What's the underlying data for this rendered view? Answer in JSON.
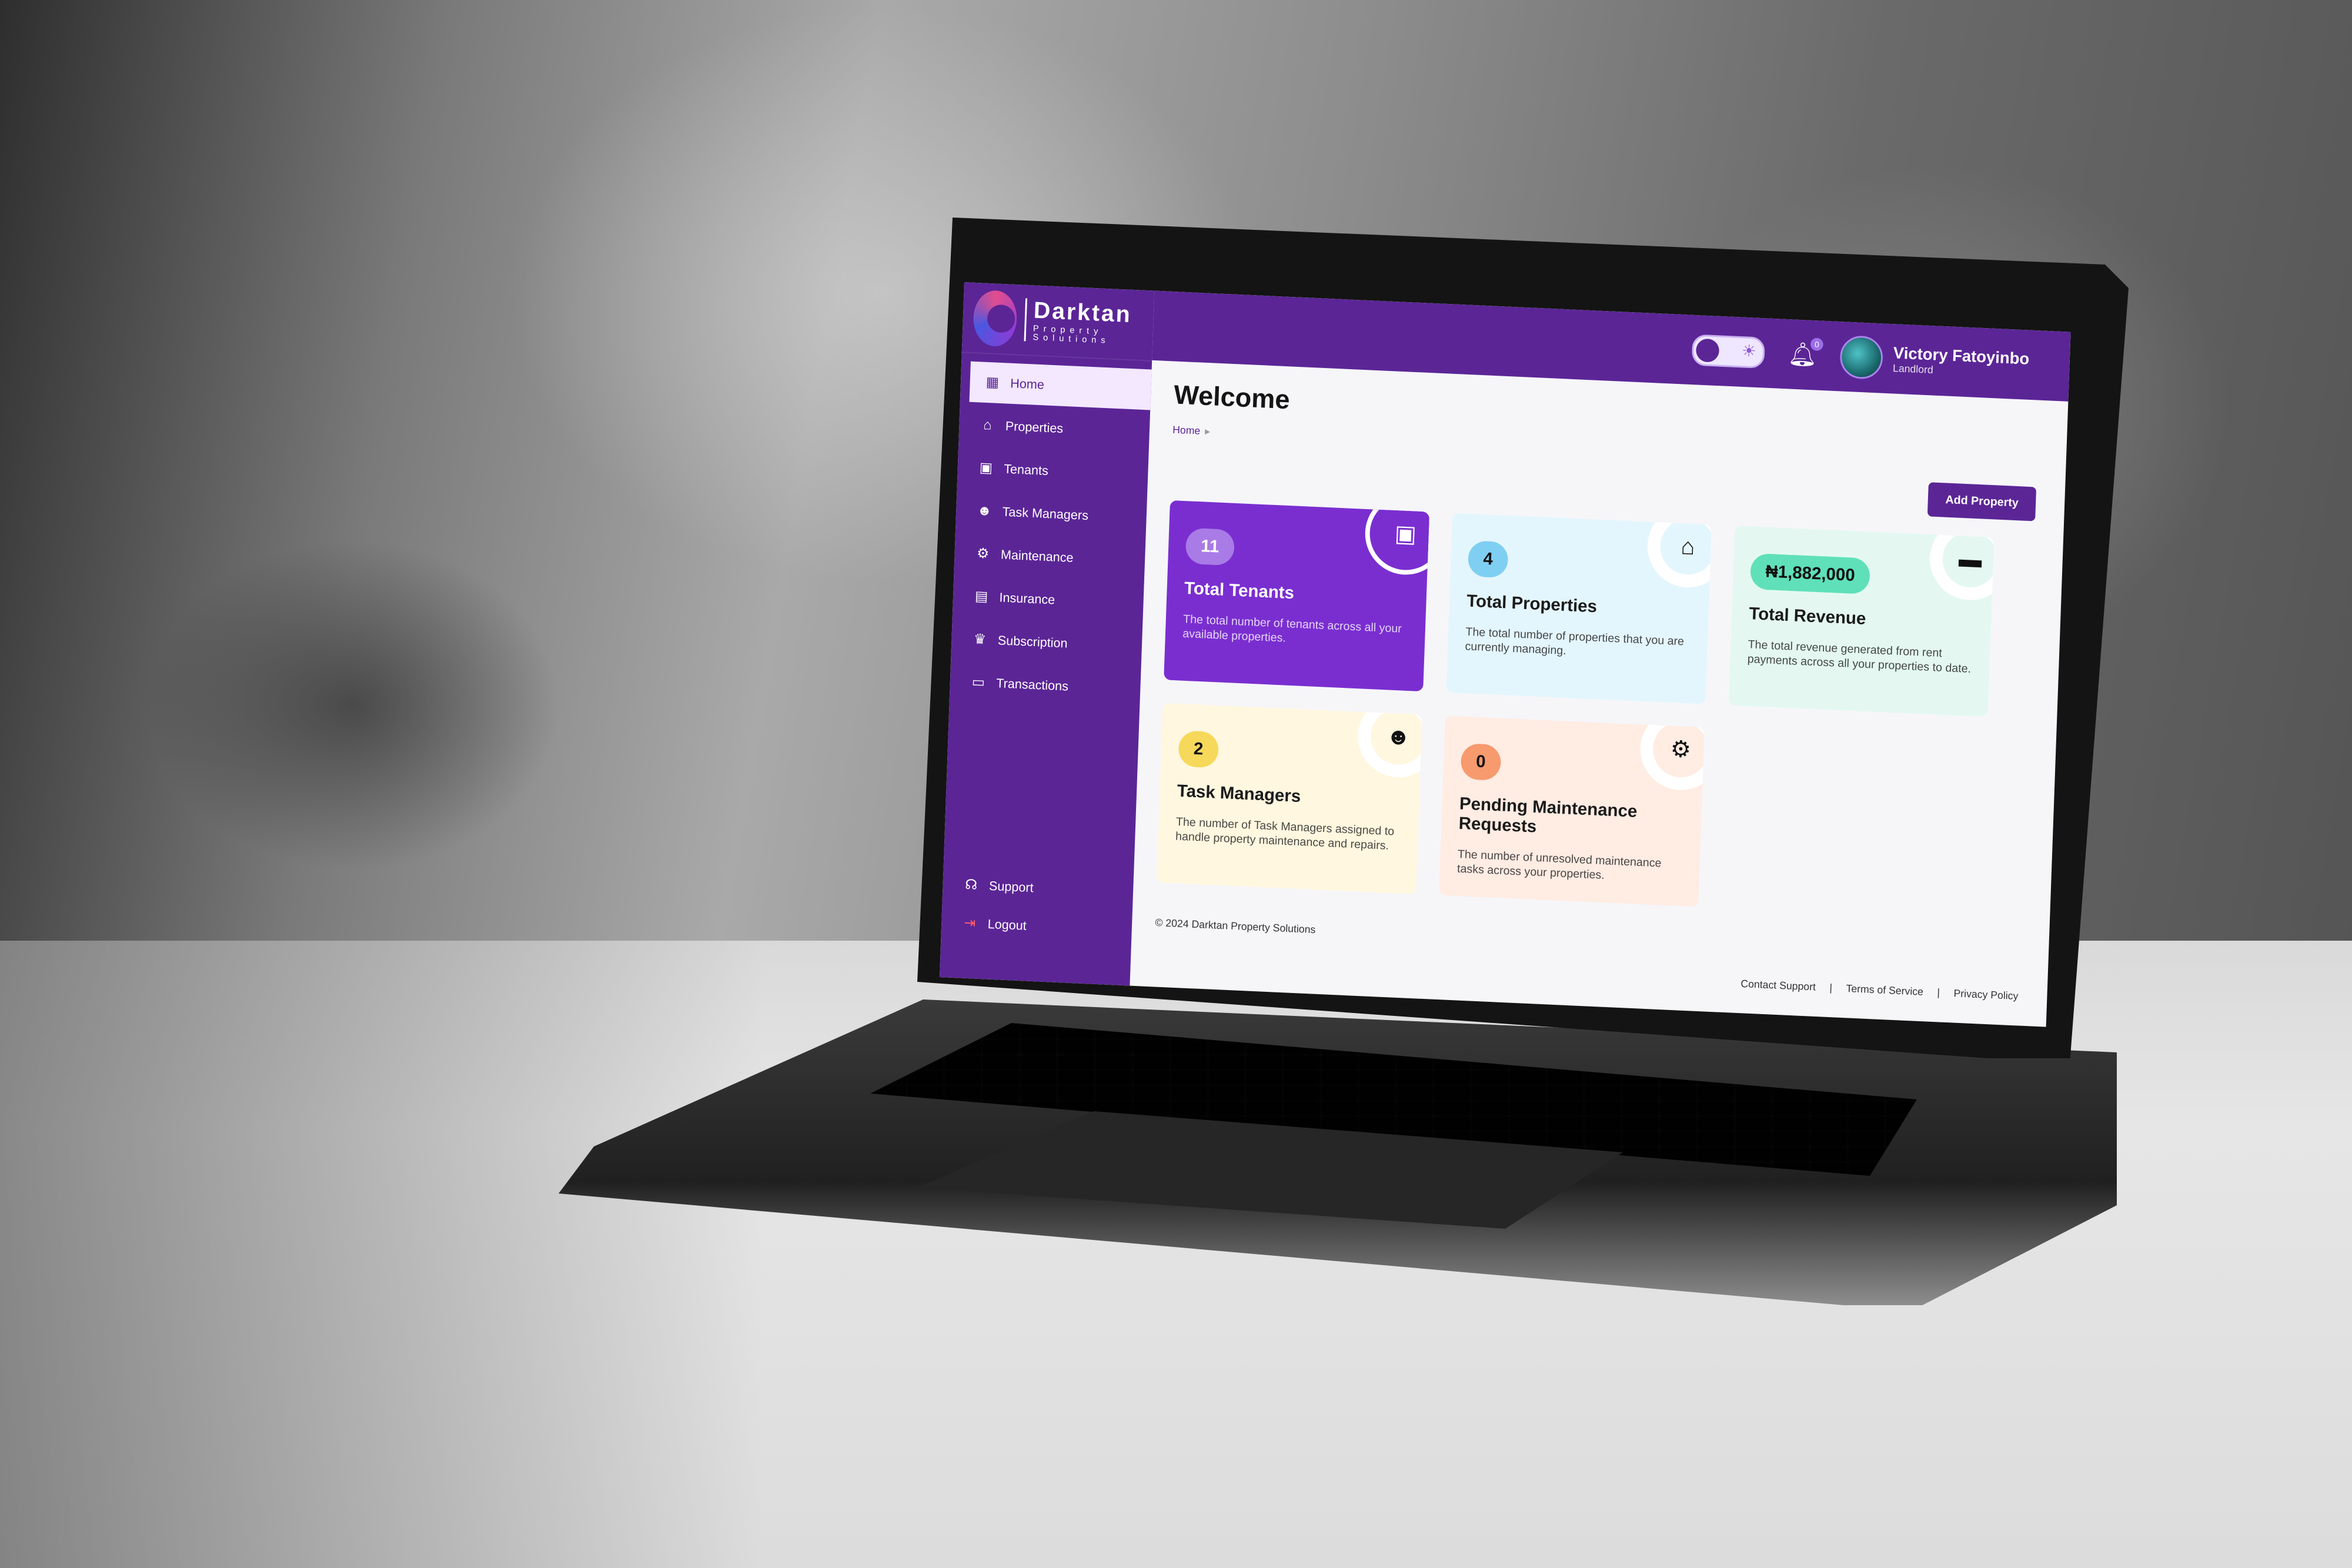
{
  "brand": {
    "name": "Darktan",
    "tagline": "Property Solutions"
  },
  "sidebar": {
    "items": [
      {
        "label": "Home",
        "icon": "grid-icon"
      },
      {
        "label": "Properties",
        "icon": "house-icon"
      },
      {
        "label": "Tenants",
        "icon": "id-card-icon"
      },
      {
        "label": "Task Managers",
        "icon": "user-gear-icon"
      },
      {
        "label": "Maintenance",
        "icon": "gear-icon"
      },
      {
        "label": "Insurance",
        "icon": "document-icon"
      },
      {
        "label": "Subscription",
        "icon": "crown-icon"
      },
      {
        "label": "Transactions",
        "icon": "wallet-icon"
      }
    ],
    "bottom": [
      {
        "label": "Support",
        "icon": "headset-icon"
      },
      {
        "label": "Logout",
        "icon": "logout-icon"
      }
    ]
  },
  "header": {
    "notification_count": "0",
    "user_name": "Victory Fatoyinbo",
    "user_role": "Landlord"
  },
  "page": {
    "title": "Welcome",
    "breadcrumb": "Home",
    "add_button": "Add Property"
  },
  "cards": {
    "tenants": {
      "value": "11",
      "title": "Total Tenants",
      "desc": "The total number of tenants across all your available properties.",
      "icon": "id-card-icon"
    },
    "properties": {
      "value": "4",
      "title": "Total Properties",
      "desc": "The total number of properties that you are currently managing.",
      "icon": "house-icon"
    },
    "revenue": {
      "value": "₦1,882,000",
      "title": "Total Revenue",
      "desc": "The total revenue generated from rent payments across all your properties to date.",
      "icon": "wallet-icon"
    },
    "managers": {
      "value": "2",
      "title": "Task Managers",
      "desc": "The number of Task Managers assigned to handle property maintenance and repairs.",
      "icon": "user-gear-icon"
    },
    "maintenance": {
      "value": "0",
      "title": "Pending Maintenance Requests",
      "desc": "The number of unresolved maintenance tasks across your properties.",
      "icon": "gear-icon"
    }
  },
  "footer": {
    "copyright": "© 2024 Darktan Property Solutions",
    "links": [
      "Contact Support",
      "Terms of Service",
      "Privacy Policy"
    ]
  },
  "colors": {
    "brand_purple": "#5b2596",
    "tenants_card": "#7a2ed0",
    "properties_card": "#e4f6fd",
    "revenue_card": "#e4f8f1",
    "managers_card": "#fff7df",
    "maintenance_card": "#ffece3"
  }
}
